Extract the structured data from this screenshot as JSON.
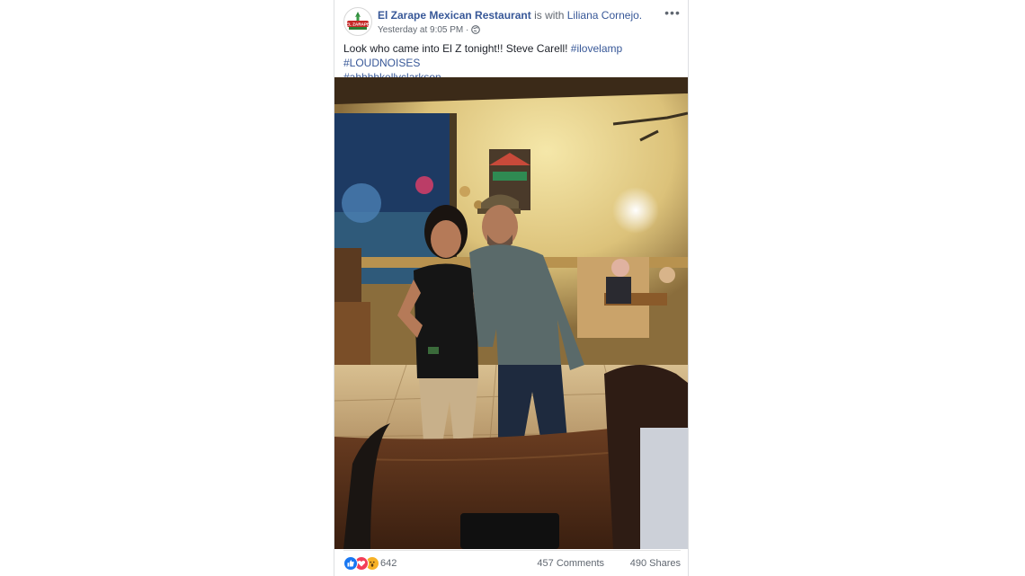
{
  "post": {
    "page_name": "El Zarape Mexican Restaurant",
    "with_text": " is with ",
    "tagged_person": "Liliana Cornejo.",
    "timestamp": "Yesterday at 9:05 PM",
    "separator": "·",
    "more_label": "•••",
    "text_main": "Look who came into El Z tonight!! Steve Carell! ",
    "hashtags": [
      "#ilovelamp",
      "#LOUDNOISES",
      "#ahhhhkellyclarkson"
    ],
    "avatar_logo_text": "EL ZARAPE"
  },
  "footer": {
    "reaction_icons": [
      "like-icon",
      "love-icon",
      "wow-icon"
    ],
    "reaction_colors": {
      "like": "#1877f2",
      "love": "#f33e58",
      "wow": "#f7b125"
    },
    "reaction_count": "642",
    "comments": "457 Comments",
    "shares": "490 Shares"
  },
  "colors": {
    "link": "#385898",
    "text": "#1d2129",
    "meta": "#606770"
  }
}
